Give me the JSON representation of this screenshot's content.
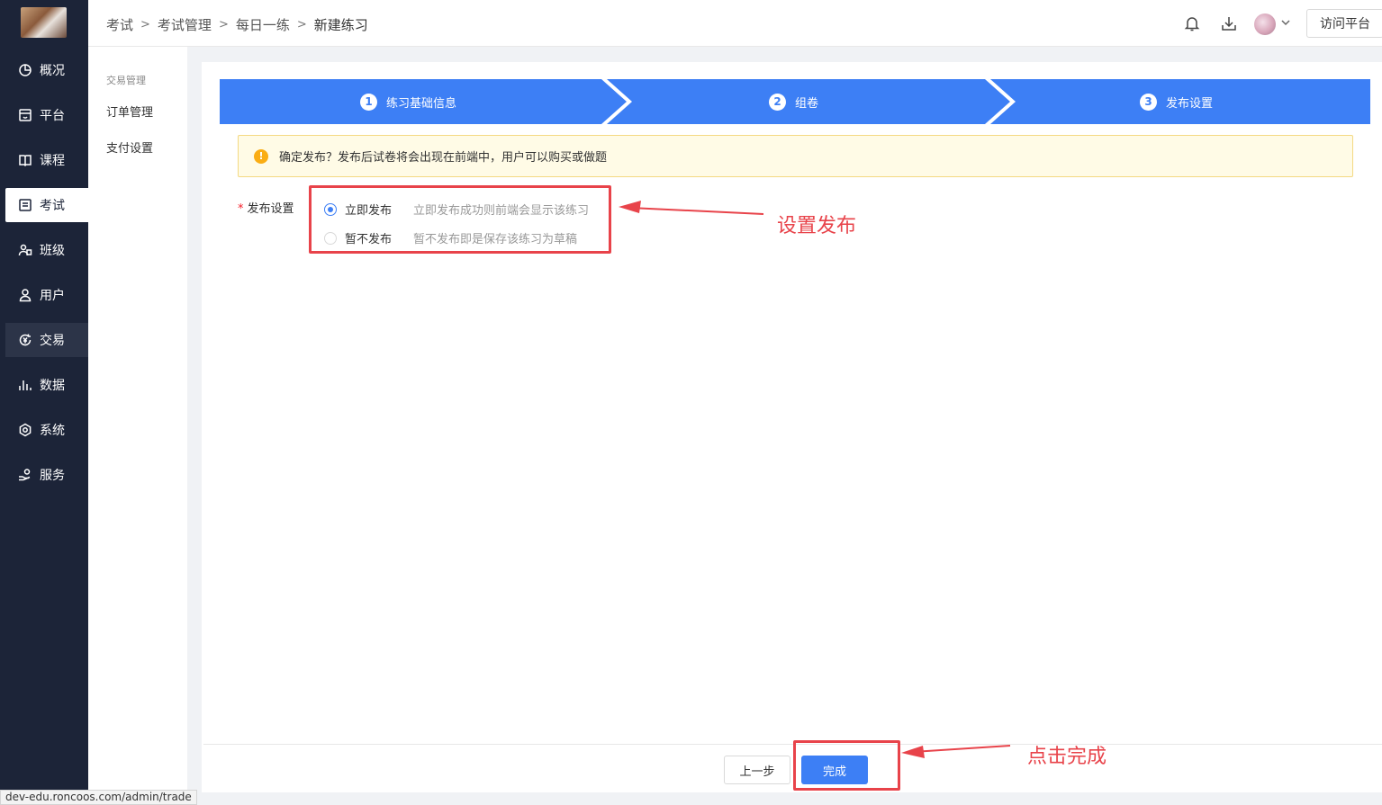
{
  "sidebar": {
    "items": [
      {
        "label": "概况",
        "icon": "dashboard-icon"
      },
      {
        "label": "平台",
        "icon": "platform-icon"
      },
      {
        "label": "课程",
        "icon": "book-icon"
      },
      {
        "label": "考试",
        "icon": "exam-icon"
      },
      {
        "label": "班级",
        "icon": "class-icon"
      },
      {
        "label": "用户",
        "icon": "user-icon"
      },
      {
        "label": "交易",
        "icon": "trade-icon"
      },
      {
        "label": "数据",
        "icon": "chart-icon"
      },
      {
        "label": "系统",
        "icon": "gear-icon"
      },
      {
        "label": "服务",
        "icon": "service-icon"
      }
    ],
    "active": "考试",
    "hovered": "交易"
  },
  "subnav": {
    "title": "交易管理",
    "items": [
      "订单管理",
      "支付设置"
    ]
  },
  "header": {
    "breadcrumb": [
      "考试",
      "考试管理",
      "每日一练",
      "新建练习"
    ],
    "visit_button": "访问平台"
  },
  "steps": [
    {
      "num": "1",
      "label": "练习基础信息"
    },
    {
      "num": "2",
      "label": "组卷"
    },
    {
      "num": "3",
      "label": "发布设置"
    }
  ],
  "alert": {
    "text": "确定发布？发布后试卷将会出现在前端中，用户可以购买或做题"
  },
  "form": {
    "label": "发布设置",
    "required_mark": "*",
    "options": [
      {
        "label": "立即发布",
        "desc": "立即发布成功则前端会显示该练习",
        "checked": true
      },
      {
        "label": "暂不发布",
        "desc": "暂不发布即是保存该练习为草稿",
        "checked": false
      }
    ]
  },
  "footer": {
    "prev_label": "上一步",
    "done_label": "完成"
  },
  "annotations": {
    "set_publish": "设置发布",
    "click_done": "点击完成"
  },
  "status_bar": {
    "url": "dev-edu.roncoos.com/admin/trade"
  },
  "colors": {
    "sidebar_bg": "#1c2438",
    "primary": "#3d7ff5",
    "annotation_red": "#e8434a",
    "alert_bg": "#fffbe6"
  }
}
